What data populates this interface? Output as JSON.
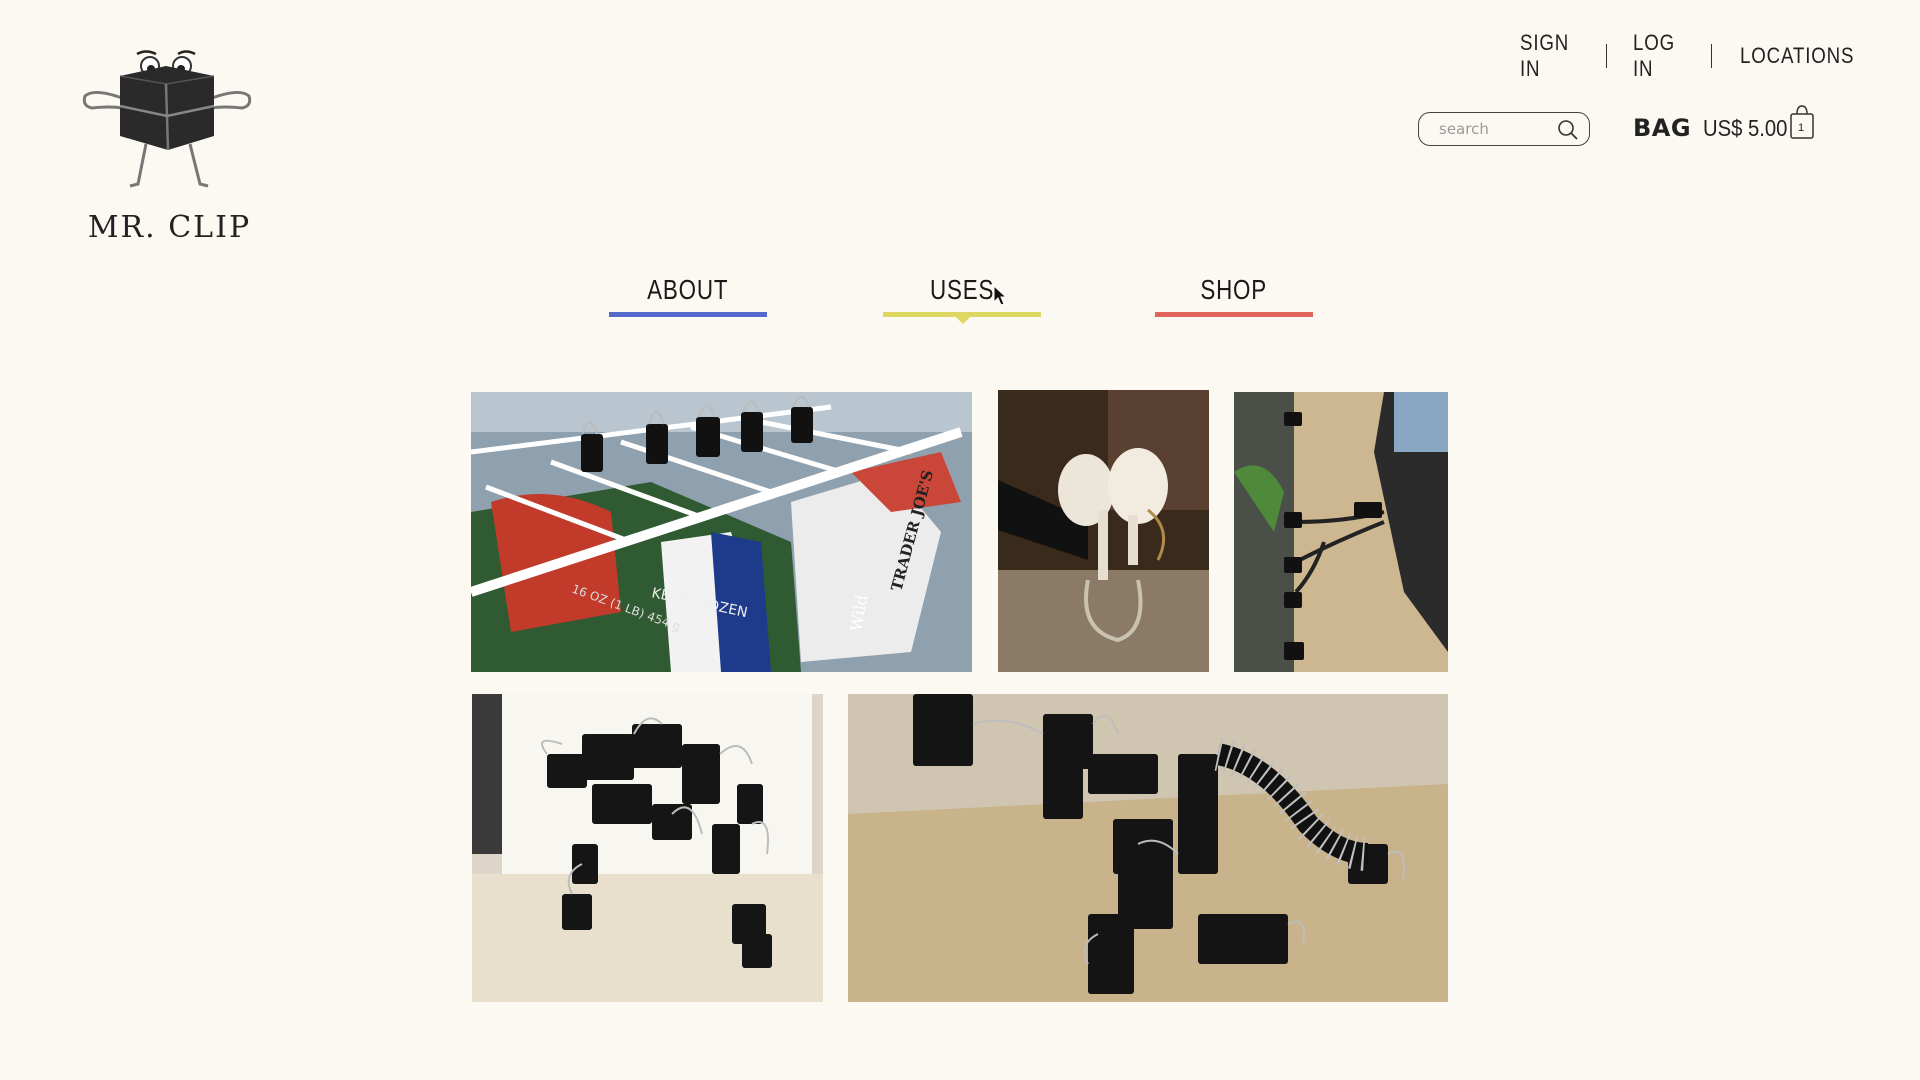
{
  "brand": {
    "name": "MR. CLIP"
  },
  "top_links": [
    "SIGN IN",
    "LOG IN",
    "LOCATIONS"
  ],
  "search": {
    "placeholder": "search"
  },
  "bag": {
    "label": "BAG",
    "price": "US$ 5.00",
    "count": "1"
  },
  "nav": {
    "items": [
      {
        "label": "ABOUT",
        "color": "#5568cc"
      },
      {
        "label": "USES",
        "color": "#dcd862",
        "active": true
      },
      {
        "label": "SHOP",
        "color": "#e0645a"
      }
    ]
  },
  "photos": {
    "freezer": {
      "text": [
        "16 OZ (1 LB) 454 g",
        "KEEP FROZEN",
        "TRADER JOE'S",
        "Wild"
      ]
    },
    "earbuds": {},
    "cables": {},
    "robot": {},
    "dinosaur": {}
  },
  "colors": {
    "background": "#fcf9f3",
    "text": "#1c1c1c"
  }
}
